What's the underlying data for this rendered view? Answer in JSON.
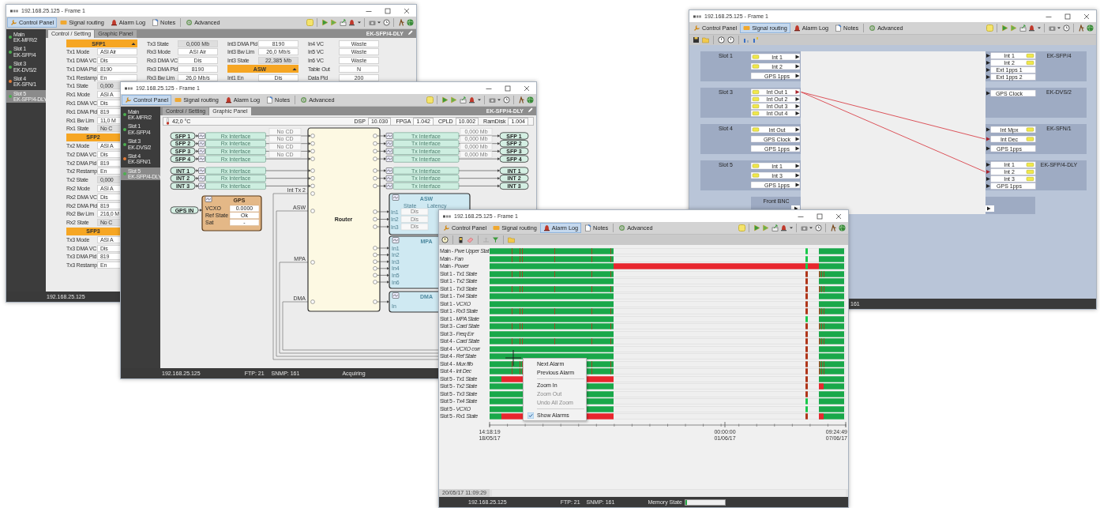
{
  "windows": [
    {
      "kind": "settings",
      "title": "192.168.25.125 - Frame 1",
      "menu": [
        {
          "label": "Control Panel",
          "selected": true
        },
        {
          "label": "Signal routing",
          "selected": false
        },
        {
          "label": "Alarm Log",
          "selected": false
        },
        {
          "label": "Notes",
          "selected": false
        },
        {
          "label": "Advanced",
          "selected": false
        }
      ],
      "sidebar": [
        {
          "title": "Main",
          "subtitle": "EK-MFR/2",
          "color": "#4caf50",
          "selected": false
        },
        {
          "title": "Slot 1",
          "subtitle": "EK-SFP/4",
          "color": "#4caf50",
          "selected": false
        },
        {
          "title": "Slot 3",
          "subtitle": "EK-DVS/2",
          "color": "#4caf50",
          "selected": false
        },
        {
          "title": "Slot 4",
          "subtitle": "EK-SFN/1",
          "color": "#e07b39",
          "selected": false
        },
        {
          "title": "Slot 5",
          "subtitle": "EK-SFP/4-DLY",
          "color": "#4caf50",
          "selected": true
        }
      ],
      "subtabs": [
        {
          "label": "Control / Setting",
          "selected": true
        },
        {
          "label": "Graphic Panel",
          "selected": false
        }
      ],
      "module": "EK-SFP/4-DLY",
      "columns": [
        [
          {
            "kind": "header",
            "label": "SFP1"
          },
          {
            "kind": "field",
            "label": "Tx1 Mode",
            "value": "ASI Air"
          },
          {
            "kind": "field",
            "label": "Tx1 DMA VC",
            "value": "Dis"
          },
          {
            "kind": "field",
            "label": "Tx1 DMA Pid",
            "value": "8190"
          },
          {
            "kind": "field",
            "label": "Tx1 Restamp",
            "value": "En"
          },
          {
            "kind": "readout",
            "label": "Tx1 State",
            "value": "0,000"
          },
          {
            "kind": "field",
            "label": "Rx1 Mode",
            "value": "ASI A"
          },
          {
            "kind": "field",
            "label": "Rx1 DMA VC",
            "value": "Dis"
          },
          {
            "kind": "field",
            "label": "Rx1 DMA Pid",
            "value": "819"
          },
          {
            "kind": "field",
            "label": "Rx1 Bw Lim",
            "value": "11,0 M"
          },
          {
            "kind": "readout",
            "label": "Rx1 State",
            "value": "No C"
          },
          {
            "kind": "header",
            "label": "SFP2"
          },
          {
            "kind": "field",
            "label": "Tx2 Mode",
            "value": "ASI A"
          },
          {
            "kind": "field",
            "label": "Tx2 DMA VC",
            "value": "Dis"
          },
          {
            "kind": "field",
            "label": "Tx2 DMA Pid",
            "value": "819"
          },
          {
            "kind": "field",
            "label": "Tx2 Restamp",
            "value": "En"
          },
          {
            "kind": "readout",
            "label": "Tx2 State",
            "value": "0,000"
          },
          {
            "kind": "field",
            "label": "Rx2 Mode",
            "value": "ASI A"
          },
          {
            "kind": "field",
            "label": "Rx2 DMA VC",
            "value": "Dis"
          },
          {
            "kind": "field",
            "label": "Rx2 DMA Pid",
            "value": "819"
          },
          {
            "kind": "field",
            "label": "Rx2 Bw Lim",
            "value": "216,0 M"
          },
          {
            "kind": "readout",
            "label": "Rx2 State",
            "value": "No C"
          },
          {
            "kind": "header",
            "label": "SFP3"
          },
          {
            "kind": "field",
            "label": "Tx3 Mode",
            "value": "ASI A"
          },
          {
            "kind": "field",
            "label": "Tx3 DMA VC",
            "value": "Dis"
          },
          {
            "kind": "field",
            "label": "Tx3 DMA Pid",
            "value": "819"
          },
          {
            "kind": "field",
            "label": "Tx3 Restamp",
            "value": "En"
          }
        ],
        [
          {
            "kind": "readout",
            "label": "Tx3 State",
            "value": "0,000 Mb"
          },
          {
            "kind": "field",
            "label": "Rx3 Mode",
            "value": "ASI Air"
          },
          {
            "kind": "field",
            "label": "Rx3 DMA VC",
            "value": "Dis"
          },
          {
            "kind": "field",
            "label": "Rx3 DMA Pid",
            "value": "8190"
          },
          {
            "kind": "field",
            "label": "Rx3 Bw Lim",
            "value": "26,0 Mb/s"
          }
        ],
        [
          {
            "kind": "field",
            "label": "Int3 DMA Pid",
            "value": "8190"
          },
          {
            "kind": "field",
            "label": "Int3 Bw Lim",
            "value": "26,0 Mb/s"
          },
          {
            "kind": "readout",
            "label": "Int3 State",
            "value": "22,385 Mb"
          },
          {
            "kind": "header",
            "label": "ASW"
          },
          {
            "kind": "field",
            "label": "Int1 En",
            "value": "Dis"
          }
        ],
        [
          {
            "kind": "field",
            "label": "In4 VC",
            "value": "Waste"
          },
          {
            "kind": "field",
            "label": "In5 VC",
            "value": "Waste"
          },
          {
            "kind": "field",
            "label": "In6 VC",
            "value": "Waste"
          },
          {
            "kind": "field",
            "label": "Table Out",
            "value": "N"
          },
          {
            "kind": "field",
            "label": "Data Pid",
            "value": "200"
          }
        ]
      ],
      "status_bar": {
        "fields": [
          "192.168.25.125"
        ]
      }
    },
    {
      "kind": "graphic",
      "title": "192.168.25.125 - Frame 1",
      "menu": [
        {
          "label": "Control Panel",
          "selected": true
        },
        {
          "label": "Signal routing",
          "selected": false
        },
        {
          "label": "Alarm Log",
          "selected": false
        },
        {
          "label": "Notes",
          "selected": false
        },
        {
          "label": "Advanced",
          "selected": false
        }
      ],
      "sidebar": [
        {
          "title": "Main",
          "subtitle": "EK-MFR/2",
          "color": "#4caf50",
          "selected": false
        },
        {
          "title": "Slot 1",
          "subtitle": "EK-SFP/4",
          "color": "#4caf50",
          "selected": false
        },
        {
          "title": "Slot 3",
          "subtitle": "EK-DVS/2",
          "color": "#4caf50",
          "selected": false
        },
        {
          "title": "Slot 4",
          "subtitle": "EK-SFN/1",
          "color": "#e07b39",
          "selected": false
        },
        {
          "title": "Slot 5",
          "subtitle": "EK-SFP/4-DLY",
          "color": "#4caf50",
          "selected": true
        }
      ],
      "subtabs": [
        {
          "label": "Control / Setting",
          "selected": false
        },
        {
          "label": "Graphic Panel",
          "selected": true
        }
      ],
      "module": "EK-SFP/4-DLY",
      "info": {
        "temperature": "42,0 °C",
        "readings": [
          {
            "label": "DSP",
            "value": "10.030"
          },
          {
            "label": "FPGA",
            "value": "1.042"
          },
          {
            "label": "CPLD",
            "value": "10.002"
          },
          {
            "label": "RamDisk",
            "value": "1.004"
          }
        ]
      },
      "diagram": {
        "sfp_rows": [
          {
            "input": "SFP 1",
            "rx": "Rx Interface",
            "carrier": "No CD",
            "tx": "Tx Interface",
            "rate": "0,000 Mb",
            "output": "SFP 1"
          },
          {
            "input": "SFP 2",
            "rx": "Rx Interface",
            "carrier": "No CD",
            "tx": "Tx Interface",
            "rate": "0,000 Mb",
            "output": "SFP 2"
          },
          {
            "input": "SFP 3",
            "rx": "Rx Interface",
            "carrier": "No CD",
            "tx": "Tx Interface",
            "rate": "0,000 Mb",
            "output": "SFP 3"
          },
          {
            "input": "SFP 4",
            "rx": "Rx Interface",
            "carrier": "No CD",
            "tx": "Tx Interface",
            "rate": "0,000 Mb",
            "output": "SFP 4"
          }
        ],
        "int_rows": [
          {
            "input": "INT 1",
            "rx": "Rx Interface",
            "tx": "Tx Interface",
            "output": "INT 1"
          },
          {
            "input": "INT 2",
            "rx": "Rx Interface",
            "tx": "Tx Interface",
            "output": "INT 2"
          },
          {
            "input": "INT 3",
            "rx": "Rx Interface",
            "tx": "Tx Interface",
            "output": "INT 3"
          }
        ],
        "gps_input": "GPS IN",
        "gps": {
          "title": "GPS",
          "fields": [
            {
              "label": "VCXO",
              "value": "0.0000"
            },
            {
              "label": "Ref State",
              "value": "Ok"
            },
            {
              "label": "Sat",
              "value": "-"
            }
          ]
        },
        "router": "Router",
        "router_inputs": [
          "Int Tx 2",
          "ASW",
          "MPA",
          "DMA"
        ],
        "asw": {
          "title": "ASW",
          "columns": [
            "State",
            "Latency"
          ],
          "inputs": [
            {
              "label": "In1",
              "state": "Dis"
            },
            {
              "label": "In2",
              "state": "Dis"
            },
            {
              "label": "In3",
              "state": "Dis"
            }
          ]
        },
        "mpa": {
          "title": "MPA",
          "inputs": [
            "In1",
            "In2",
            "In3",
            "In4",
            "In5",
            "In6"
          ]
        },
        "dma": {
          "title": "DMA",
          "inputs": [
            "In"
          ]
        }
      },
      "status_bar": {
        "fields": [
          "192.168.25.125",
          "FTP: 21",
          "SNMP: 161",
          "Acquiring"
        ]
      }
    },
    {
      "kind": "routing",
      "title": "192.168.25.125 - Frame 1",
      "menu": [
        {
          "label": "Control Panel",
          "selected": false
        },
        {
          "label": "Signal routing",
          "selected": true
        },
        {
          "label": "Alarm Log",
          "selected": false
        },
        {
          "label": "Notes",
          "selected": false
        },
        {
          "label": "Advanced",
          "selected": false
        }
      ],
      "routing": {
        "slots": [
          {
            "name": "Slot 1",
            "module": "EK-SFP/4",
            "inputs": [
              {
                "label": "Int 1",
                "tag": true,
                "routed": false
              },
              {
                "label": "Int 2",
                "tag": true,
                "routed": false
              },
              {
                "label": "GPS 1pps",
                "tag": false,
                "routed": false
              }
            ],
            "outputs": [
              {
                "label": "Int 1",
                "tag": true,
                "routed": false
              },
              {
                "label": "Int 2",
                "tag": true,
                "routed": false
              },
              {
                "label": "Ext 1pps 1",
                "tag": false,
                "routed": false
              },
              {
                "label": "Ext 1pps 2",
                "tag": false,
                "routed": false
              }
            ]
          },
          {
            "name": "Slot 3",
            "module": "EK-DVS/2",
            "inputs": [
              {
                "label": "Int Out 1",
                "tag": true,
                "routed": true
              },
              {
                "label": "Int Out 2",
                "tag": true,
                "routed": false
              },
              {
                "label": "Int Out 3",
                "tag": true,
                "routed": false
              },
              {
                "label": "Int Out 4",
                "tag": true,
                "routed": false
              }
            ],
            "outputs": [
              {
                "label": "GPS Clock",
                "tag": false,
                "routed": false
              }
            ]
          },
          {
            "name": "Slot 4",
            "module": "EK-SFN/1",
            "inputs": [
              {
                "label": "Int Out",
                "tag": true,
                "routed": false
              },
              {
                "label": "GPS Clock",
                "tag": false,
                "routed": false
              },
              {
                "label": "GPS 1pps",
                "tag": false,
                "routed": false
              }
            ],
            "outputs": [
              {
                "label": "Int Mpx",
                "tag": true,
                "routed": false
              },
              {
                "label": "Int Dec",
                "tag": true,
                "routed": true
              },
              {
                "label": "GPS 1pps",
                "tag": false,
                "routed": false
              }
            ]
          },
          {
            "name": "Slot 5",
            "module": "EK-SFP/4-DLY",
            "inputs": [
              {
                "label": "Int 1",
                "tag": true,
                "routed": false
              },
              {
                "label": "Int 3",
                "tag": true,
                "routed": false
              },
              {
                "label": "GPS 1pps",
                "tag": false,
                "routed": false
              }
            ],
            "outputs": [
              {
                "label": "Int 1",
                "tag": true,
                "routed": false
              },
              {
                "label": "Int 2",
                "tag": true,
                "routed": true
              },
              {
                "label": "Int 3",
                "tag": true,
                "routed": false
              },
              {
                "label": "GPS 1pps",
                "tag": false,
                "routed": false
              }
            ]
          }
        ],
        "front": "Front BNC"
      },
      "status_bar": {
        "fields": [
          "161"
        ]
      }
    },
    {
      "kind": "alarm",
      "title": "192.168.25.125 - Frame 1",
      "menu": [
        {
          "label": "Control Panel",
          "selected": false
        },
        {
          "label": "Signal routing",
          "selected": false
        },
        {
          "label": "Alarm Log",
          "selected": true
        },
        {
          "label": "Notes",
          "selected": false
        },
        {
          "label": "Advanced",
          "selected": false
        }
      ],
      "alarms": [
        {
          "label": "Main - *Pwe Upper Stat*",
          "kind": "marks",
          "marker_alarm": false,
          "tail_marks": false,
          "tail_fault": false
        },
        {
          "label": "Main - *Fan*",
          "kind": "marks",
          "marker_alarm": false,
          "tail_marks": false,
          "tail_fault": false
        },
        {
          "label": "Main - *Power*",
          "kind": "power-fault",
          "marker_alarm": false,
          "tail_marks": false,
          "tail_fault": false
        },
        {
          "label": "Slot 1 - *Tx1 State*",
          "kind": "marks",
          "marker_alarm": true,
          "tail_marks": true,
          "tail_fault": false
        },
        {
          "label": "Slot 1 - *Tx2 State*",
          "kind": "ok",
          "marker_alarm": true,
          "tail_marks": false,
          "tail_fault": false
        },
        {
          "label": "Slot 1 - *Tx3 State*",
          "kind": "marks",
          "marker_alarm": true,
          "tail_marks": true,
          "tail_fault": false
        },
        {
          "label": "Slot 1 - *Tx4 State*",
          "kind": "ok",
          "marker_alarm": true,
          "tail_marks": false,
          "tail_fault": false
        },
        {
          "label": "Slot 1 - *VCXO*",
          "kind": "ok",
          "marker_alarm": true,
          "tail_marks": false,
          "tail_fault": false
        },
        {
          "label": "Slot 1 - *Rx3 State*",
          "kind": "marks",
          "marker_alarm": true,
          "tail_marks": true,
          "tail_fault": false
        },
        {
          "label": "Slot 1 - *MPA State*",
          "kind": "ok",
          "marker_alarm": false,
          "tail_marks": false,
          "tail_fault": false
        },
        {
          "label": "Slot 3 - *Card State*",
          "kind": "marks",
          "marker_alarm": true,
          "tail_marks": true,
          "tail_fault": false
        },
        {
          "label": "Slot 3 - *Freq Err*",
          "kind": "ok",
          "marker_alarm": true,
          "tail_marks": false,
          "tail_fault": false
        },
        {
          "label": "Slot 4 - *Card State*",
          "kind": "marks",
          "marker_alarm": true,
          "tail_marks": true,
          "tail_fault": false
        },
        {
          "label": "Slot 4 - *VCXO corr*",
          "kind": "ok",
          "marker_alarm": true,
          "tail_marks": false,
          "tail_fault": false
        },
        {
          "label": "Slot 4 - *Ref State*",
          "kind": "ok",
          "marker_alarm": true,
          "tail_marks": false,
          "tail_fault": false
        },
        {
          "label": "Slot 4 - *Mux fifo*",
          "kind": "marks",
          "marker_alarm": true,
          "tail_marks": true,
          "tail_fault": false
        },
        {
          "label": "Slot 4 - *Int Dec*",
          "kind": "marks",
          "marker_alarm": true,
          "tail_marks": true,
          "tail_fault": false
        },
        {
          "label": "Slot 5 - *Tx1 State*",
          "kind": "start-fault",
          "marker_alarm": true,
          "tail_marks": false,
          "tail_fault": false
        },
        {
          "label": "Slot 5 - *Tx2 State*",
          "kind": "ok",
          "marker_alarm": true,
          "tail_marks": false,
          "tail_fault": true
        },
        {
          "label": "Slot 5 - *Tx3 State*",
          "kind": "ok",
          "marker_alarm": true,
          "tail_marks": false,
          "tail_fault": false
        },
        {
          "label": "Slot 5 - *Tx4 State*",
          "kind": "ok",
          "marker_alarm": false,
          "tail_marks": false,
          "tail_fault": false
        },
        {
          "label": "Slot 5 - *VCXO*",
          "kind": "ok",
          "marker_alarm": false,
          "tail_marks": false,
          "tail_fault": false
        },
        {
          "label": "Slot 5 - *Rx1 State*",
          "kind": "start-fault",
          "marker_alarm": true,
          "tail_marks": false,
          "tail_fault": true
        }
      ],
      "axis": [
        {
          "time": "14:18:19",
          "date": "18/05/17"
        },
        {
          "time": "00:00:00",
          "date": "01/06/17"
        },
        {
          "time": "09:24:49",
          "date": "07/06/17"
        }
      ],
      "scroll_position": "20/05/17 11:09:29",
      "context_menu": [
        {
          "kind": "item",
          "label": "Next Alarm",
          "disabled": false,
          "checked": false
        },
        {
          "kind": "item",
          "label": "Previous Alarm",
          "disabled": false,
          "checked": false
        },
        {
          "kind": "separator"
        },
        {
          "kind": "item",
          "label": "Zoom In",
          "disabled": false,
          "checked": false
        },
        {
          "kind": "item",
          "label": "Zoom Out",
          "disabled": true,
          "checked": false
        },
        {
          "kind": "item",
          "label": "Undo All Zoom",
          "disabled": true,
          "checked": false
        },
        {
          "kind": "separator"
        },
        {
          "kind": "item",
          "label": "Show Alarms",
          "disabled": false,
          "checked": true
        }
      ],
      "status_bar": {
        "fields": [
          "192.168.25.125",
          "FTP: 21",
          "SNMP: 161"
        ],
        "memory": {
          "label": "Memory State",
          "level": 0.04
        }
      }
    }
  ]
}
